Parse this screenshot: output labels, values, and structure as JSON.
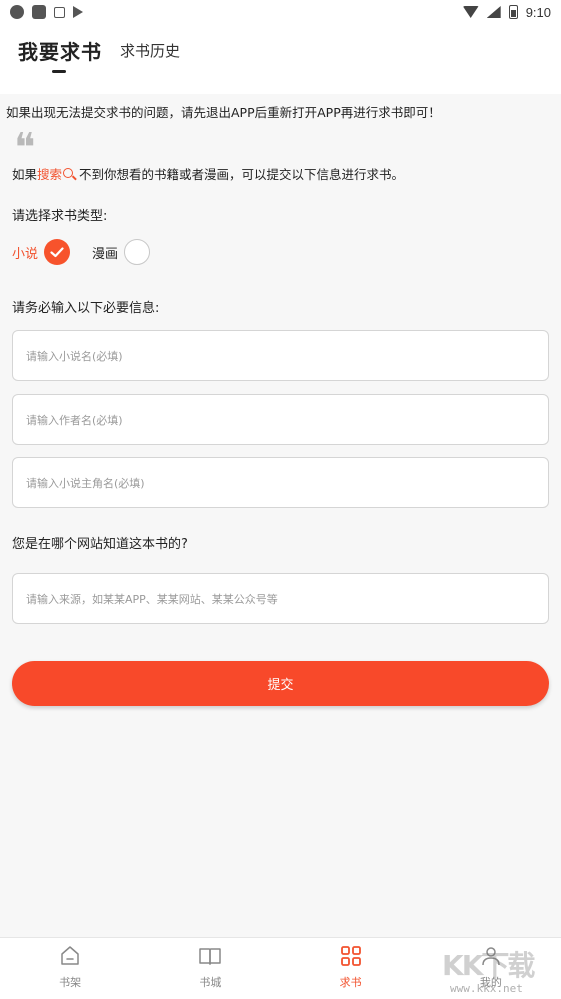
{
  "status_bar": {
    "time": "9:10"
  },
  "tabs": {
    "active_label": "我要求书",
    "inactive_label": "求书历史"
  },
  "content": {
    "notice": "如果出现无法提交求书的问题，请先退出APP后重新打开APP再进行求书即可！",
    "quote_mark": "❝",
    "intro_before": "如果",
    "intro_highlight": "搜索",
    "intro_after": "不到你想看的书籍或者漫画，可以提交以下信息进行求书。",
    "type_section_label": "请选择求书类型:",
    "type_options": [
      {
        "label": "小说",
        "selected": true
      },
      {
        "label": "漫画",
        "selected": false
      }
    ],
    "required_section_label": "请务必输入以下必要信息:",
    "fields": {
      "novel_name_placeholder": "请输入小说名(必填)",
      "author_placeholder": "请输入作者名(必填)",
      "protagonist_placeholder": "请输入小说主角名(必填)",
      "source_placeholder": "请输入来源，如某某APP、某某网站、某某公众号等"
    },
    "source_question": "您是在哪个网站知道这本书的?",
    "submit_label": "提交"
  },
  "bottom_nav": [
    {
      "label": "书架",
      "icon": "bookshelf-icon",
      "active": false
    },
    {
      "label": "书城",
      "icon": "bookstore-icon",
      "active": false
    },
    {
      "label": "求书",
      "icon": "request-book-icon",
      "active": true
    },
    {
      "label": "我的",
      "icon": "profile-icon",
      "active": false
    }
  ],
  "watermark": {
    "text": "KK下载",
    "url": "www.kkx.net"
  },
  "colors": {
    "accent": "#f8492a",
    "background": "#f7f7f7"
  }
}
